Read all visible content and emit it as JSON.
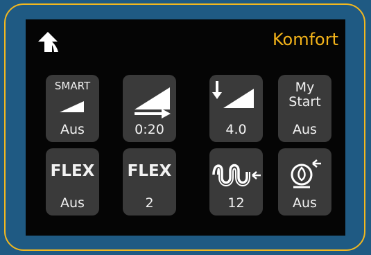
{
  "header": {
    "title": "Komfort",
    "back_icon": "back-arrow-icon"
  },
  "colors": {
    "accent": "#f4b41a",
    "frame": "#f2b81f",
    "background": "#1f5a83",
    "screen": "#050505",
    "tile": "#3a3a3a"
  },
  "tiles": [
    {
      "label": "SMART",
      "value": "Aus",
      "icon": "smart-ramp-icon"
    },
    {
      "value": "0:20",
      "icon": "ramp-time-icon"
    },
    {
      "value": "4.0",
      "icon": "start-pressure-icon"
    },
    {
      "label_line1": "My",
      "label_line2": "Start",
      "value": "Aus"
    },
    {
      "label": "FLEX",
      "value": "Aus"
    },
    {
      "label": "FLEX",
      "value": "2"
    },
    {
      "value": "12",
      "icon": "tube-setting-icon"
    },
    {
      "value": "Aus",
      "icon": "mask-fit-icon"
    }
  ]
}
